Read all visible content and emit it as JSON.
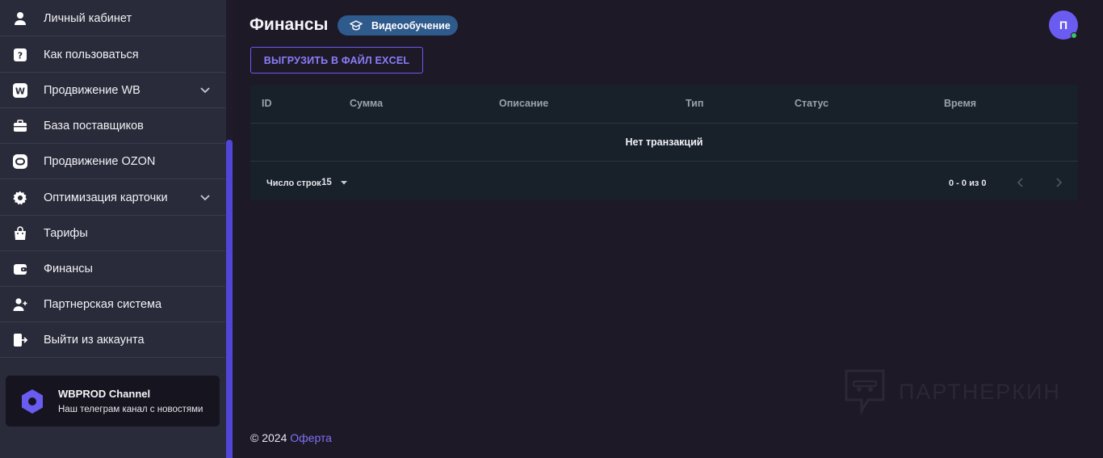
{
  "sidebar": {
    "items": [
      {
        "label": "Личный кабинет",
        "icon": "user-icon"
      },
      {
        "label": "Как пользоваться",
        "icon": "question-icon"
      },
      {
        "label": "Продвижение WB",
        "icon": "wb-logo-icon",
        "expandable": true
      },
      {
        "label": "База поставщиков",
        "icon": "briefcase-icon"
      },
      {
        "label": "Продвижение OZON",
        "icon": "ozon-logo-icon"
      },
      {
        "label": "Оптимизация карточки",
        "icon": "gear-icon",
        "expandable": true
      },
      {
        "label": "Тарифы",
        "icon": "shopping-bag-icon"
      },
      {
        "label": "Финансы",
        "icon": "wallet-icon"
      },
      {
        "label": "Партнерская система",
        "icon": "user-plus-icon"
      },
      {
        "label": "Выйти из аккаунта",
        "icon": "logout-icon"
      }
    ],
    "telegram": {
      "title": "WBPROD Channel",
      "subtitle": "Наш телеграм канал с новостями"
    }
  },
  "header": {
    "title": "Финансы",
    "video_button": "Видеообучение",
    "avatar_initial": "П"
  },
  "toolbar": {
    "excel_button": "ВЫГРУЗИТЬ В ФАЙЛ EXCEL"
  },
  "table": {
    "columns": [
      "ID",
      "Сумма",
      "Описание",
      "Тип",
      "Статус",
      "Время"
    ],
    "empty_text": "Нет транзакций",
    "rows_per_page_label": "Число строк",
    "rows_per_page_value": "15",
    "range_text": "0 - 0 из 0"
  },
  "watermark": {
    "text": "ПАРТНЕРКИН"
  },
  "footer": {
    "copyright": "© 2024",
    "offer_link": "Оферта"
  },
  "colors": {
    "background": "#1d1927",
    "sidebar": "#2a2b3a",
    "accent": "#6a5cf0",
    "table": "#18202a",
    "video_button": "#2e5a8c"
  }
}
